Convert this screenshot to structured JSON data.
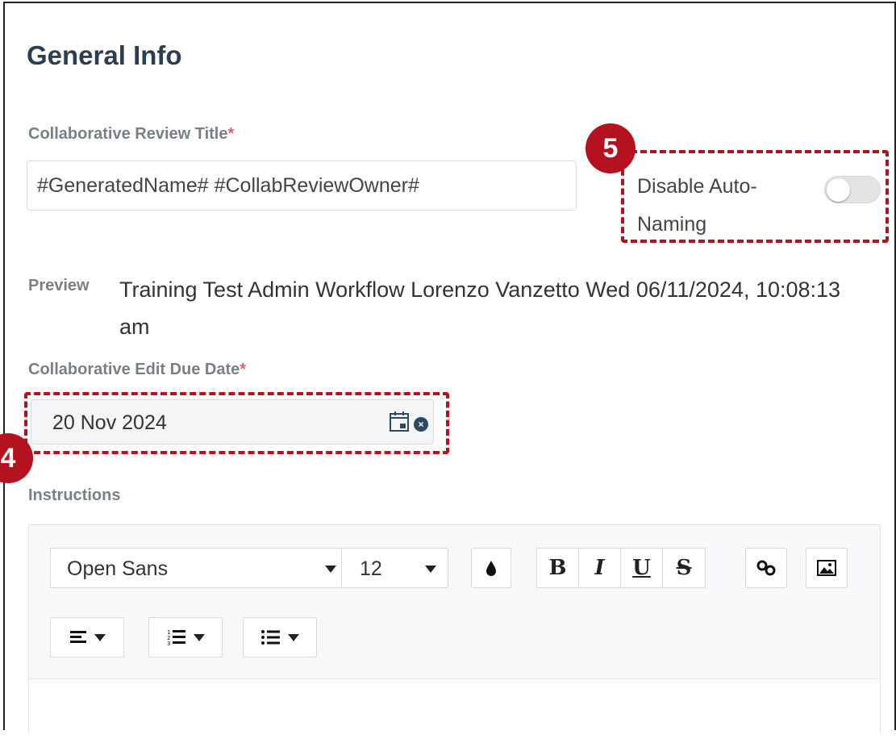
{
  "section": {
    "title": "General Info"
  },
  "review_title": {
    "label": "Collaborative Review Title",
    "required_mark": "*",
    "value": "#GeneratedName# #CollabReviewOwner#"
  },
  "auto_naming": {
    "label": "Disable Auto-Naming",
    "enabled": false
  },
  "preview": {
    "label": "Preview",
    "text": "Training Test Admin Workflow Lorenzo Vanzetto Wed 06/11/2024, 10:08:13 am"
  },
  "due_date": {
    "label": "Collaborative Edit Due Date",
    "required_mark": "*",
    "value": "20 Nov 2024"
  },
  "instructions": {
    "label": "Instructions",
    "toolbar": {
      "font_family": "Open Sans",
      "font_size": "12",
      "bold": "B",
      "italic": "I",
      "underline": "U",
      "strikethrough": "S",
      "icons": [
        "color-drop-icon",
        "link-icon",
        "image-icon",
        "align-left-icon",
        "ordered-list-icon",
        "unordered-list-icon"
      ]
    }
  },
  "callouts": {
    "date": "4",
    "toggle": "5"
  },
  "colors": {
    "callout": "#b3121e",
    "required": "#e4606d",
    "title": "#2c3e50"
  }
}
